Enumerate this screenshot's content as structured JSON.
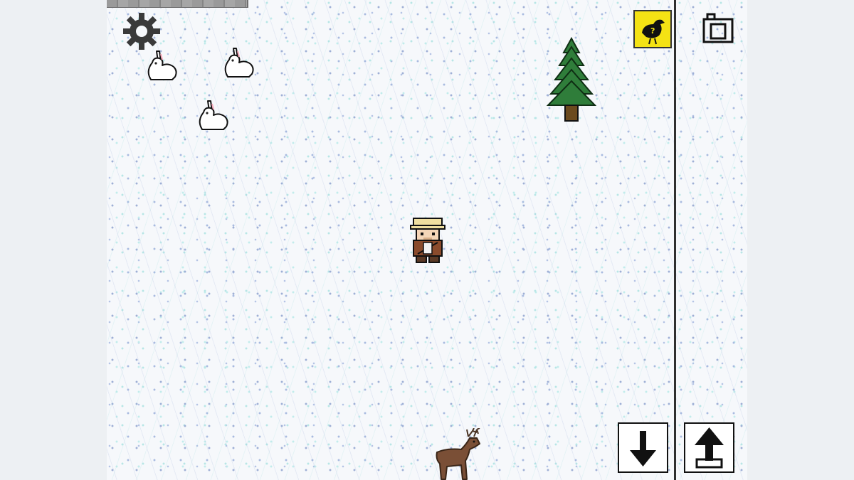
{
  "controls": {
    "settings": {
      "icon": "gear-icon"
    },
    "bird_guide": {
      "icon": "bird-question-icon",
      "background": "#f4e214"
    },
    "camera": {
      "icon": "camera-icon"
    },
    "move_down": {
      "icon": "arrow-down-icon"
    },
    "move_up": {
      "icon": "arrow-up-icon"
    }
  },
  "world": {
    "terrain": "snow",
    "sprites": [
      {
        "kind": "rabbit",
        "icon": "rabbit-icon"
      },
      {
        "kind": "rabbit",
        "icon": "rabbit-icon"
      },
      {
        "kind": "rabbit",
        "icon": "rabbit-icon"
      },
      {
        "kind": "pine-tree",
        "icon": "pine-tree-icon"
      },
      {
        "kind": "player",
        "icon": "explorer-character-icon"
      },
      {
        "kind": "deer",
        "icon": "deer-icon"
      }
    ]
  },
  "colors": {
    "snow": "#f6f8fb",
    "accent_yellow": "#f4e214",
    "divider": "#2f2f2f",
    "tree_green": "#2f7d3a",
    "deer_brown": "#7a4f36"
  }
}
